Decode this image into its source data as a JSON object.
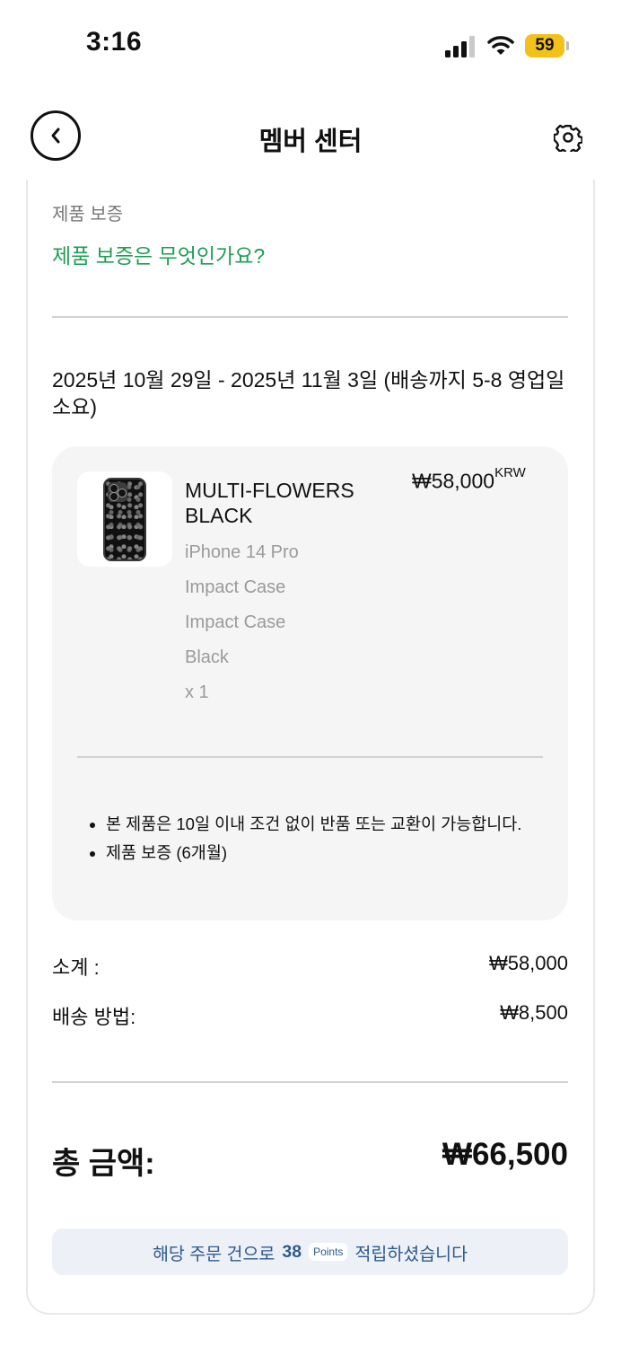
{
  "status_bar": {
    "time": "3:16",
    "battery": "59"
  },
  "nav": {
    "title": "멤버 센터"
  },
  "warranty": {
    "section_label": "제품 보증",
    "link_text": "제품 보증은 무엇인가요?"
  },
  "delivery_text": "2025년 10월 29일 - 2025년 11월 3일 (배송까지 5-8 영업일 소요)",
  "product": {
    "name": "MULTI-FLOWERS BLACK",
    "price": "₩58,000",
    "currency": "KRW",
    "specs": [
      "iPhone 14 Pro",
      "Impact Case",
      "Impact Case",
      "Black",
      "x 1"
    ],
    "notes": [
      "본 제품은 10일 이내 조건 없이 반품 또는 교환이 가능합니다.",
      "제품 보증 (6개월)"
    ]
  },
  "summary": {
    "subtotal_label": "소계 :",
    "subtotal_value": "₩58,000",
    "shipping_label": "배송 방법:",
    "shipping_value": "₩8,500",
    "total_label": "총 금액:",
    "total_value": "₩66,500"
  },
  "points": {
    "prefix": "해당 주문 건으로",
    "amount": "38",
    "unit": "Points",
    "suffix": "적립하셨습니다"
  },
  "icons": [
    "signal-icon",
    "wifi-icon",
    "battery-icon",
    "back-chevron-icon",
    "gear-icon"
  ],
  "colors": {
    "link_green": "#1f9d55",
    "points_blue": "#2f5a8c",
    "battery_yellow": "#f2c21b"
  }
}
